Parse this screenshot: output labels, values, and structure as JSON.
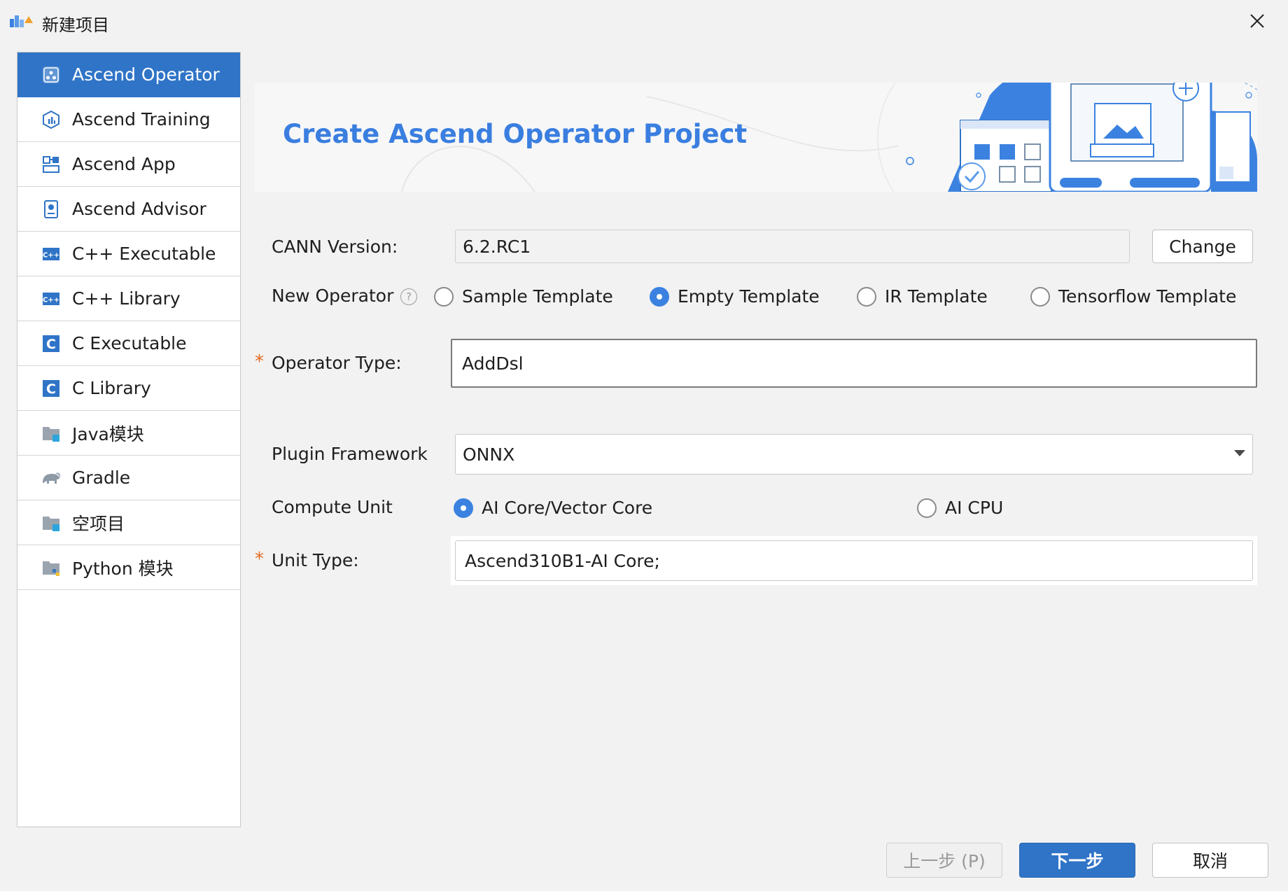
{
  "window": {
    "title": "新建项目",
    "close_icon": "close-icon"
  },
  "sidebar": {
    "items": [
      {
        "label": "Ascend Operator",
        "icon": "ascend-operator-icon",
        "selected": true
      },
      {
        "label": "Ascend Training",
        "icon": "ascend-training-icon"
      },
      {
        "label": "Ascend App",
        "icon": "ascend-app-icon"
      },
      {
        "label": "Ascend Advisor",
        "icon": "ascend-advisor-icon"
      },
      {
        "label": "C++ Executable",
        "icon": "cpp-icon"
      },
      {
        "label": "C++ Library",
        "icon": "cpp-icon"
      },
      {
        "label": "C Executable",
        "icon": "c-icon"
      },
      {
        "label": "C Library",
        "icon": "c-icon"
      },
      {
        "label": "Java模块",
        "icon": "folder-icon"
      },
      {
        "label": "Gradle",
        "icon": "gradle-elephant-icon"
      },
      {
        "label": "空项目",
        "icon": "folder-icon"
      },
      {
        "label": "Python 模块",
        "icon": "python-folder-icon"
      }
    ]
  },
  "banner": {
    "title": "Create Ascend Operator Project",
    "accent": "#3a7ee0"
  },
  "form": {
    "cann_version": {
      "label": "CANN Version:",
      "value": "6.2.RC1",
      "button": "Change"
    },
    "new_operator": {
      "label": "New Operator",
      "help_icon": "question-icon",
      "options": [
        "Sample Template",
        "Empty Template",
        "IR Template",
        "Tensorflow Template"
      ],
      "selected": "Empty Template"
    },
    "operator_type": {
      "label": "Operator Type:",
      "value": "AddDsl",
      "required_mark": "*"
    },
    "plugin_framework": {
      "label": "Plugin Framework",
      "value": "ONNX"
    },
    "compute_unit": {
      "label": "Compute Unit",
      "options": [
        "AI Core/Vector Core",
        "AI CPU"
      ],
      "selected": "AI Core/Vector Core"
    },
    "unit_type": {
      "label": "Unit Type:",
      "value": "Ascend310B1-AI Core;",
      "required_mark": "*"
    }
  },
  "footer": {
    "prev_label": "上一步 (P)",
    "next_label": "下一步",
    "cancel_label": "取消"
  },
  "colors": {
    "primary": "#2f74c7",
    "required": "#e26a1b"
  }
}
